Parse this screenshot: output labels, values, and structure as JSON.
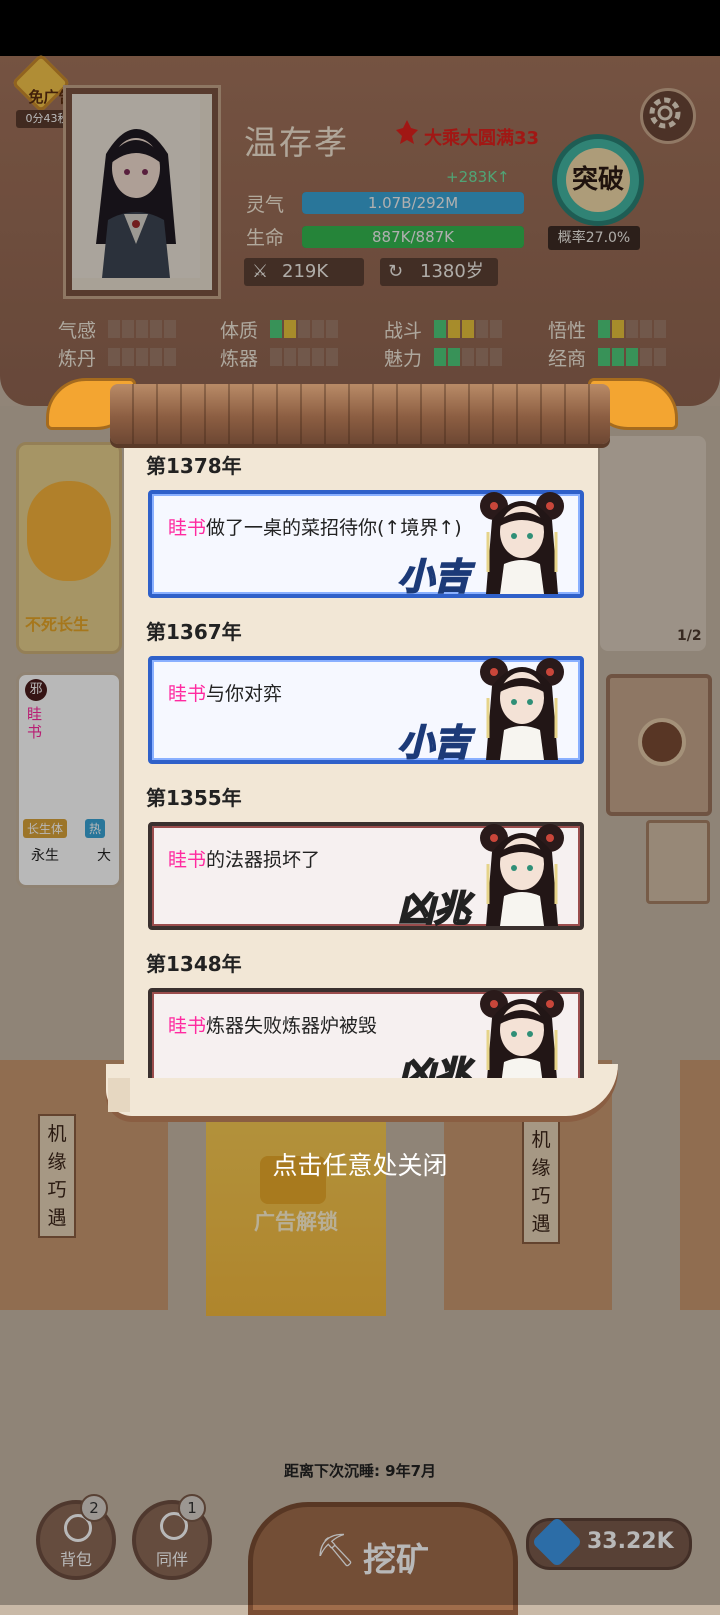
{
  "header": {
    "no_ad_label": "免广告",
    "no_ad_timer": "0分43秒",
    "character_name": "温存孝",
    "realm": "大乘大圆满33",
    "spirit_gain": "+283K↑",
    "spirit_label": "灵气",
    "spirit_value": "1.07B/292M",
    "spirit_fill": 1.0,
    "life_label": "生命",
    "life_value": "887K/887K",
    "life_fill": 1.0,
    "breakthrough_label": "突破",
    "breakthrough_prob": "概率27.0%",
    "attack_value": "219K",
    "age_value": "1380岁"
  },
  "attributes": [
    {
      "label": "气感",
      "pips": [
        "e",
        "e",
        "e",
        "e",
        "e"
      ]
    },
    {
      "label": "体质",
      "pips": [
        "g",
        "y",
        "e",
        "e",
        "e"
      ]
    },
    {
      "label": "战斗",
      "pips": [
        "g",
        "y",
        "y",
        "e",
        "e"
      ]
    },
    {
      "label": "悟性",
      "pips": [
        "g",
        "y",
        "e",
        "e",
        "e"
      ]
    },
    {
      "label": "炼丹",
      "pips": [
        "e",
        "e",
        "e",
        "e",
        "e"
      ]
    },
    {
      "label": "炼器",
      "pips": [
        "e",
        "e",
        "e",
        "e",
        "e"
      ]
    },
    {
      "label": "魅力",
      "pips": [
        "g",
        "g",
        "e",
        "e",
        "e"
      ]
    },
    {
      "label": "经商",
      "pips": [
        "g",
        "g",
        "g",
        "e",
        "e"
      ]
    }
  ],
  "background": {
    "card1_label": "不死长生",
    "card2_tag1": "长生体",
    "card2_tag2": "热",
    "card2_line1": "永生",
    "card2_line2": "大",
    "card2_side": "眭书",
    "card2_badge": "邪",
    "page_indicator": "1/2",
    "scroll_left_text": "机缘巧遇",
    "scroll_right_text": "机缘巧遇",
    "ad_unlock": "广告解锁",
    "sleep_text": "距离下次沉睡: 9年7月"
  },
  "bottom_bar": {
    "bag_label": "背包",
    "bag_badge": "2",
    "companion_label": "同伴",
    "companion_badge": "1",
    "mine_label": "挖矿",
    "gem_value": "33.22K"
  },
  "overlay": {
    "close_hint": "点击任意处关闭"
  },
  "log": [
    {
      "year": "第1378年",
      "name": "眭书",
      "text": "做了一桌的菜招待你(↑境界↑)",
      "type": "good",
      "stamp": "小吉"
    },
    {
      "year": "第1367年",
      "name": "眭书",
      "text": "与你对弈",
      "type": "good",
      "stamp": "小吉"
    },
    {
      "year": "第1355年",
      "name": "眭书",
      "text": "的法器损坏了",
      "type": "bad",
      "stamp": "凶兆"
    },
    {
      "year": "第1348年",
      "name": "眭书",
      "text": "炼器失败炼器炉被毁",
      "type": "bad",
      "stamp": "凶兆"
    }
  ],
  "colors": {
    "spirit_bar": "#3aa4d6",
    "life_bar": "#34b84f",
    "name_highlight": "#ff2aa0",
    "good_border": "#2f60c9",
    "bad_border": "#3a302e"
  }
}
